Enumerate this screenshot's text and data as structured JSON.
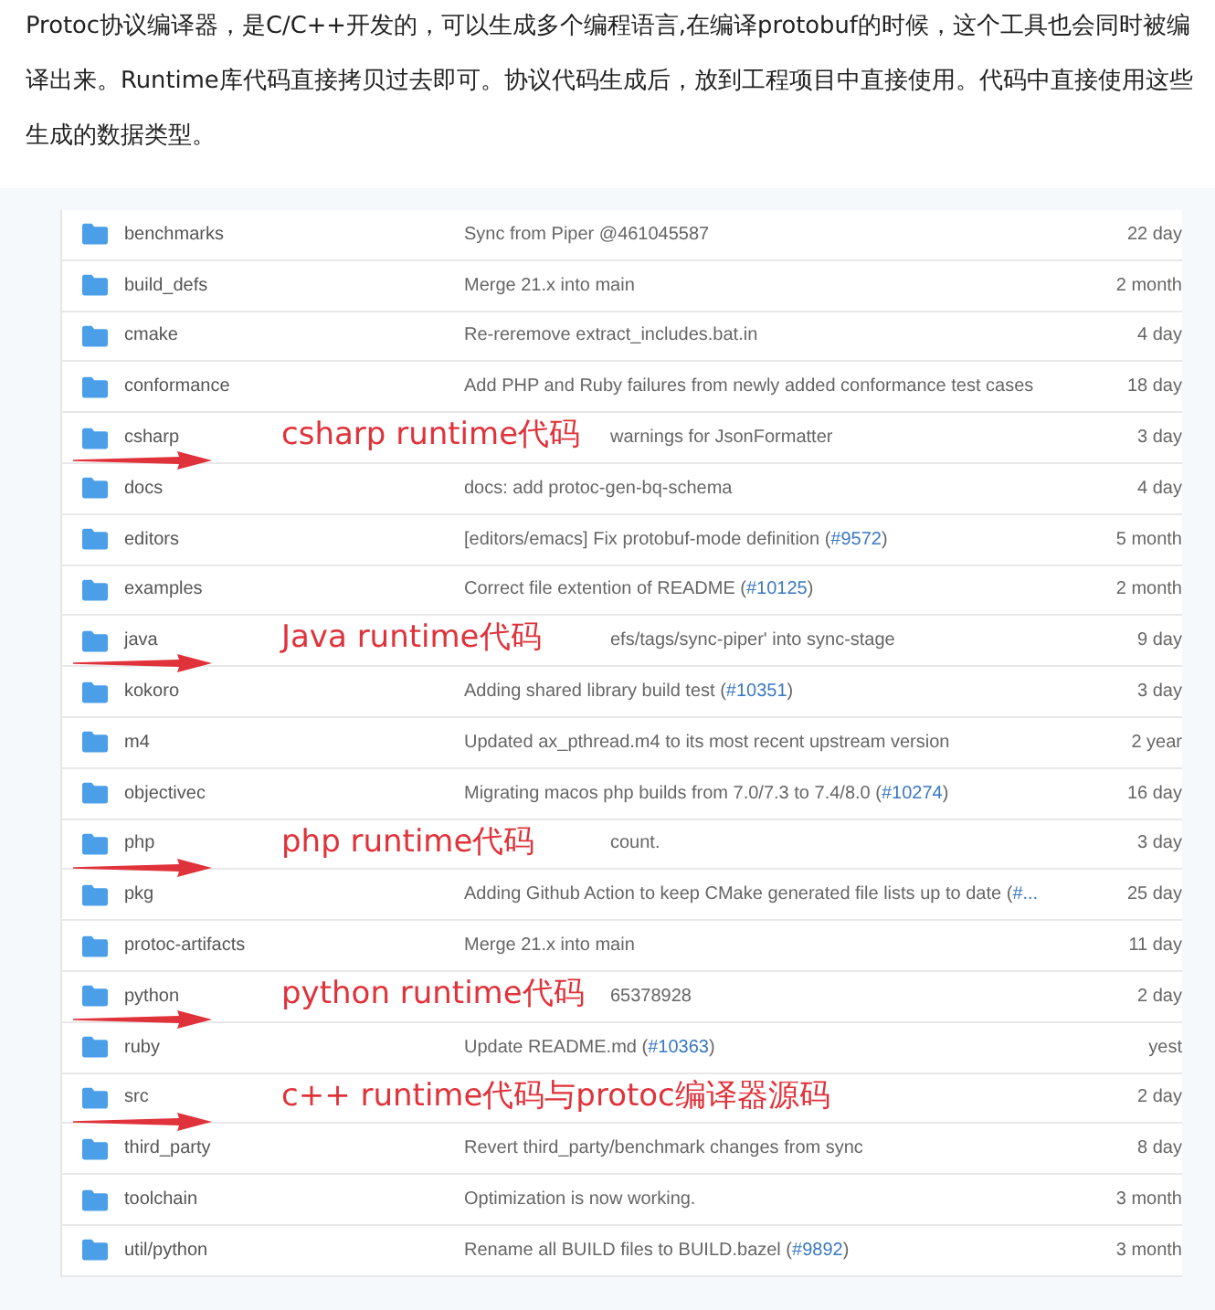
{
  "paragraph": "Protoc协议编译器，是C/C++开发的，可以生成多个编程语言,在编译protobuf的时候，这个工具也会同时被编译出来。Runtime库代码直接拷贝过去即可。协议代码生成后，放到工程项目中直接使用。代码中直接使用这些生成的数据类型。",
  "rows": [
    {
      "name": "benchmarks",
      "message": "Sync from Piper @461045587",
      "age": "22 day"
    },
    {
      "name": "build_defs",
      "message": "Merge 21.x into main",
      "age": "2 month"
    },
    {
      "name": "cmake",
      "message": "Re-reremove extract_includes.bat.in",
      "age": "4 day"
    },
    {
      "name": "conformance",
      "message": "Add PHP and Ruby failures from newly added conformance test cases",
      "age": "18 day"
    },
    {
      "name": "csharp",
      "message": "warnings for JsonFormatter",
      "age": "3 day",
      "annotation": "csharp runtime代码"
    },
    {
      "name": "docs",
      "message": "docs: add protoc-gen-bq-schema",
      "age": "4 day"
    },
    {
      "name": "editors",
      "message": "[editors/emacs] Fix protobuf-mode definition (",
      "link": "#9572",
      "message_end": ")",
      "age": "5 month"
    },
    {
      "name": "examples",
      "message": "Correct file extention of README (",
      "link": "#10125",
      "message_end": ")",
      "age": "2 month"
    },
    {
      "name": "java",
      "message": "efs/tags/sync-piper' into sync-stage",
      "age": "9 day",
      "annotation": "Java runtime代码"
    },
    {
      "name": "kokoro",
      "message": "Adding shared library build test (",
      "link": "#10351",
      "message_end": ")",
      "age": "3 day"
    },
    {
      "name": "m4",
      "message": "Updated ax_pthread.m4 to its most recent upstream version",
      "age": "2 year"
    },
    {
      "name": "objectivec",
      "message": "Migrating macos php builds from 7.0/7.3 to 7.4/8.0 (",
      "link": "#10274",
      "message_end": ")",
      "age": "16 day"
    },
    {
      "name": "php",
      "message": "count.",
      "age": "3 day",
      "annotation": "php runtime代码"
    },
    {
      "name": "pkg",
      "message": "Adding Github Action to keep CMake generated file lists up to date (",
      "link": "#...",
      "age": "25 day"
    },
    {
      "name": "protoc-artifacts",
      "message": "Merge 21.x into main",
      "age": "11 day"
    },
    {
      "name": "python",
      "message": "65378928",
      "age": "2 day",
      "annotation": "python runtime代码"
    },
    {
      "name": "ruby",
      "message": "Update README.md (",
      "link": "#10363",
      "message_end": ")",
      "age": "yest"
    },
    {
      "name": "src",
      "age": "2 day",
      "annotation": "c++ runtime代码与protoc编译器源码"
    },
    {
      "name": "third_party",
      "message": "Revert third_party/benchmark changes from sync",
      "age": "8 day"
    },
    {
      "name": "toolchain",
      "message": "Optimization is now working.",
      "age": "3 month"
    },
    {
      "name": "util/python",
      "message": "Rename all BUILD files to BUILD.bazel (",
      "link": "#9892",
      "message_end": ")",
      "age": "3 month"
    }
  ]
}
